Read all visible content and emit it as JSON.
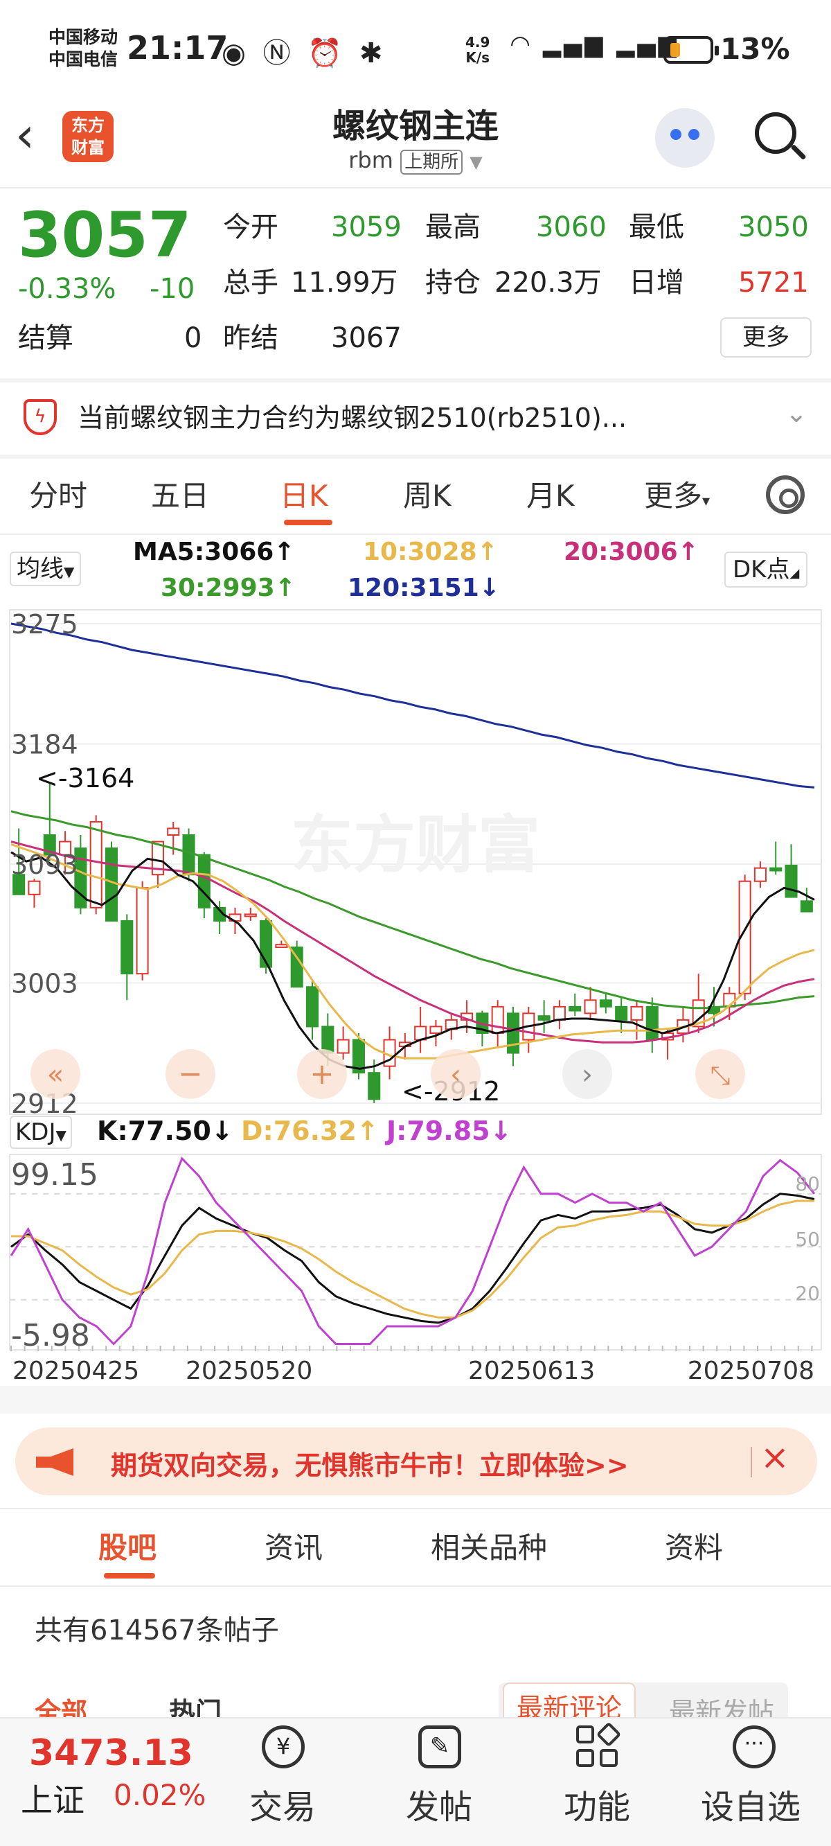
{
  "status_bar": {
    "carrier1": "中国移动",
    "carrier2": "中国电信",
    "time": "21:17",
    "net_speed_value": "4.9",
    "net_speed_unit": "K/s",
    "battery": "13%"
  },
  "header": {
    "logo_line1": "东方",
    "logo_line2": "财富",
    "title": "螺纹钢主连",
    "code": "rbm",
    "exchange": "上期所"
  },
  "quote": {
    "price": "3057",
    "change_pct": "-0.33%",
    "change": "-10",
    "settle_label": "结算",
    "settle_value": "0",
    "open_label": "今开",
    "open_value": "3059",
    "high_label": "最高",
    "high_value": "3060",
    "low_label": "最低",
    "low_value": "3050",
    "volume_label": "总手",
    "volume_value": "11.99万",
    "oi_label": "持仓",
    "oi_value": "220.3万",
    "daily_inc_label": "日增",
    "daily_inc_value": "5721",
    "prev_settle_label": "昨结",
    "prev_settle_value": "3067",
    "more_label": "更多"
  },
  "notice": {
    "text": "当前螺纹钢主力合约为螺纹钢2510(rb2510)..."
  },
  "chart_tabs": [
    "分时",
    "五日",
    "日K",
    "周K",
    "月K",
    "更多"
  ],
  "chart_tabs_active": "日K",
  "ma_legend": {
    "select_label": "均线",
    "ma5": "MA5:3066↑",
    "ma10": "10:3028↑",
    "ma20": "20:3006↑",
    "ma30": "30:2993↑",
    "ma120": "120:3151↓",
    "dk_label": "DK点",
    "colors": {
      "ma5": "#111111",
      "ma10": "#e8b84a",
      "ma20": "#c8307a",
      "ma30": "#3a9a2a",
      "ma120": "#1e2f9a"
    }
  },
  "watermark": "东方财富",
  "chart_data": [
    {
      "type": "candlestick",
      "title": "",
      "y_ticks": [
        "3275",
        "3184",
        "3093",
        "3003",
        "2912"
      ],
      "ylim": [
        2912,
        3275
      ],
      "x_ticks": [
        "20250425",
        "20250520",
        "20250613",
        "20250708"
      ],
      "annotations": {
        "max": "<-3164",
        "min": "<-2912"
      },
      "candles": [
        [
          3085,
          3120,
          3070,
          3070
        ],
        [
          3070,
          3082,
          3060,
          3080
        ],
        [
          3115,
          3155,
          3095,
          3100
        ],
        [
          3100,
          3118,
          3085,
          3110
        ],
        [
          3105,
          3115,
          3055,
          3060
        ],
        [
          3060,
          3130,
          3055,
          3125
        ],
        [
          3105,
          3110,
          3050,
          3050
        ],
        [
          3050,
          3055,
          2990,
          3010
        ],
        [
          3010,
          3080,
          3005,
          3075
        ],
        [
          3085,
          3110,
          3075,
          3110
        ],
        [
          3115,
          3125,
          3100,
          3120
        ],
        [
          3115,
          3120,
          3080,
          3085
        ],
        [
          3100,
          3102,
          3052,
          3060
        ],
        [
          3060,
          3065,
          3040,
          3050
        ],
        [
          3050,
          3060,
          3040,
          3055
        ],
        [
          3055,
          3060,
          3050,
          3055
        ],
        [
          3050,
          3052,
          3010,
          3015
        ],
        [
          3030,
          3035,
          3030,
          3032
        ],
        [
          3030,
          3035,
          3010,
          3000
        ],
        [
          3000,
          3005,
          2960,
          2970
        ],
        [
          2970,
          2980,
          2940,
          2950
        ],
        [
          2950,
          2970,
          2945,
          2960
        ],
        [
          2960,
          2965,
          2930,
          2935
        ],
        [
          2935,
          2945,
          2912,
          2915
        ],
        [
          2940,
          2970,
          2930,
          2960
        ],
        [
          2955,
          2965,
          2945,
          2958
        ],
        [
          2960,
          2985,
          2950,
          2970
        ],
        [
          2965,
          2975,
          2955,
          2970
        ],
        [
          2968,
          2980,
          2960,
          2975
        ],
        [
          2975,
          2990,
          2965,
          2980
        ],
        [
          2980,
          2982,
          2955,
          2965
        ],
        [
          2965,
          2990,
          2955,
          2985
        ],
        [
          2980,
          2985,
          2940,
          2950
        ],
        [
          2960,
          2985,
          2950,
          2980
        ],
        [
          2978,
          2990,
          2965,
          2975
        ],
        [
          2975,
          2990,
          2968,
          2985
        ],
        [
          2985,
          2995,
          2978,
          2982
        ],
        [
          2980,
          3000,
          2975,
          2990
        ],
        [
          2990,
          2995,
          2980,
          2985
        ],
        [
          2985,
          2992,
          2965,
          2975
        ],
        [
          2975,
          2990,
          2960,
          2985
        ],
        [
          2985,
          2992,
          2950,
          2960
        ],
        [
          2960,
          2968,
          2945,
          2965
        ],
        [
          2965,
          2985,
          2958,
          2975
        ],
        [
          2970,
          3010,
          2965,
          2990
        ],
        [
          2985,
          3000,
          2970,
          2980
        ],
        [
          2985,
          3000,
          2975,
          2995
        ],
        [
          2995,
          3085,
          2990,
          3080
        ],
        [
          3080,
          3095,
          3075,
          3090
        ],
        [
          3090,
          3110,
          3085,
          3088
        ],
        [
          3092,
          3108,
          3080,
          3068
        ],
        [
          3065,
          3075,
          3060,
          3057
        ]
      ],
      "series": [
        {
          "name": "MA120",
          "values": [
            3275,
            3273,
            3271,
            3268,
            3266,
            3263,
            3261,
            3258,
            3255,
            3253,
            3251,
            3249,
            3247,
            3245,
            3243,
            3241,
            3239,
            3237,
            3235,
            3232,
            3230,
            3227,
            3225,
            3222,
            3220,
            3217,
            3215,
            3212,
            3210,
            3207,
            3205,
            3202,
            3199,
            3197,
            3194,
            3191,
            3189,
            3186,
            3183,
            3181,
            3178,
            3176,
            3173,
            3171,
            3168,
            3166,
            3164,
            3162,
            3160,
            3158,
            3156,
            3154,
            3152,
            3151
          ]
        },
        {
          "name": "MA30",
          "values": [
            3133,
            3130,
            3128,
            3126,
            3123,
            3121,
            3118,
            3115,
            3113,
            3110,
            3107,
            3104,
            3101,
            3097,
            3093,
            3089,
            3085,
            3081,
            3076,
            3072,
            3067,
            3063,
            3058,
            3053,
            3049,
            3045,
            3041,
            3037,
            3033,
            3029,
            3025,
            3021,
            3018,
            3014,
            3011,
            3008,
            3005,
            3002,
            2999,
            2996,
            2993,
            2990,
            2988,
            2986,
            2985,
            2984,
            2984,
            2985,
            2986,
            2987,
            2988,
            2990,
            2992,
            2993
          ]
        },
        {
          "name": "MA20",
          "values": [
            3110,
            3107,
            3104,
            3101,
            3098,
            3096,
            3094,
            3092,
            3091,
            3090,
            3089,
            3088,
            3086,
            3082,
            3076,
            3070,
            3065,
            3058,
            3050,
            3043,
            3036,
            3029,
            3022,
            3015,
            3008,
            3002,
            2996,
            2990,
            2985,
            2980,
            2976,
            2972,
            2970,
            2968,
            2966,
            2964,
            2962,
            2960,
            2959,
            2958,
            2958,
            2958,
            2959,
            2961,
            2963,
            2966,
            2970,
            2976,
            2983,
            2990,
            2996,
            3001,
            3004,
            3006
          ]
        },
        {
          "name": "MA10",
          "values": [
            3108,
            3104,
            3100,
            3095,
            3090,
            3085,
            3082,
            3078,
            3076,
            3074,
            3078,
            3084,
            3086,
            3085,
            3080,
            3072,
            3063,
            3051,
            3036,
            3020,
            3003,
            2987,
            2973,
            2961,
            2953,
            2948,
            2946,
            2946,
            2946,
            2948,
            2950,
            2952,
            2954,
            2956,
            2958,
            2960,
            2962,
            2964,
            2965,
            2966,
            2967,
            2967,
            2967,
            2968,
            2969,
            2971,
            2975,
            2982,
            2992,
            3004,
            3014,
            3020,
            3025,
            3028
          ]
        },
        {
          "name": "MA5",
          "values": [
            3102,
            3095,
            3098,
            3090,
            3076,
            3066,
            3062,
            3070,
            3088,
            3097,
            3095,
            3085,
            3080,
            3068,
            3055,
            3048,
            3035,
            3015,
            2990,
            2970,
            2955,
            2945,
            2940,
            2938,
            2940,
            2945,
            2955,
            2960,
            2963,
            2968,
            2970,
            2968,
            2965,
            2967,
            2970,
            2972,
            2975,
            2976,
            2976,
            2975,
            2974,
            2973,
            2968,
            2965,
            2968,
            2972,
            2982,
            3005,
            3035,
            3055,
            3068,
            3075,
            3072,
            3066
          ]
        }
      ]
    },
    {
      "type": "line",
      "title": "",
      "ylim": [
        -5.98,
        99.15
      ],
      "y_ticks": [
        "99.15",
        "-5.98"
      ],
      "ref_lines": [
        "80",
        "50",
        "20"
      ],
      "series": [
        {
          "name": "K",
          "values": [
            50,
            57,
            48,
            40,
            30,
            25,
            20,
            15,
            28,
            45,
            62,
            72,
            66,
            62,
            58,
            55,
            48,
            42,
            30,
            22,
            18,
            15,
            12,
            10,
            8,
            7,
            10,
            15,
            25,
            38,
            52,
            65,
            68,
            66,
            70,
            70,
            71,
            72,
            74,
            68,
            60,
            58,
            62,
            66,
            74,
            80,
            79,
            77
          ]
        },
        {
          "name": "D",
          "values": [
            56,
            56,
            52,
            48,
            40,
            33,
            27,
            23,
            26,
            35,
            48,
            57,
            59,
            59,
            58,
            56,
            53,
            49,
            43,
            36,
            30,
            25,
            20,
            15,
            12,
            10,
            10,
            14,
            22,
            32,
            44,
            55,
            61,
            62,
            65,
            67,
            68,
            70,
            70,
            67,
            63,
            62,
            62,
            65,
            70,
            74,
            76,
            76
          ]
        },
        {
          "name": "J",
          "values": [
            45,
            60,
            40,
            20,
            10,
            5,
            -5,
            5,
            35,
            75,
            100,
            90,
            75,
            65,
            55,
            45,
            35,
            25,
            5,
            -5,
            -5,
            -5,
            5,
            5,
            5,
            5,
            10,
            25,
            50,
            75,
            95,
            80,
            80,
            75,
            80,
            75,
            75,
            70,
            75,
            60,
            45,
            50,
            60,
            70,
            90,
            99,
            92,
            80
          ]
        }
      ]
    }
  ],
  "kdj_legend": {
    "select_label": "KDJ",
    "k": "K:77.50↓",
    "d": "D:76.32↑",
    "j": "J:79.85↓",
    "colors": {
      "k": "#111111",
      "d": "#e8b84a",
      "j": "#c040d0"
    }
  },
  "ad": {
    "text": "期货双向交易，无惧熊市牛市！立即体验>>"
  },
  "bottom_tabs": [
    "股吧",
    "资讯",
    "相关品种",
    "资料"
  ],
  "bottom_tabs_active": "股吧",
  "posts_count_text": "共有614567条帖子",
  "post_filters": [
    "全部",
    "热门",
    "最新评论",
    "最新发帖"
  ],
  "footer": {
    "index_value": "3473.13",
    "index_name": "上证",
    "index_change": "0.02%",
    "nav": [
      "交易",
      "发帖",
      "功能",
      "设自选"
    ]
  }
}
